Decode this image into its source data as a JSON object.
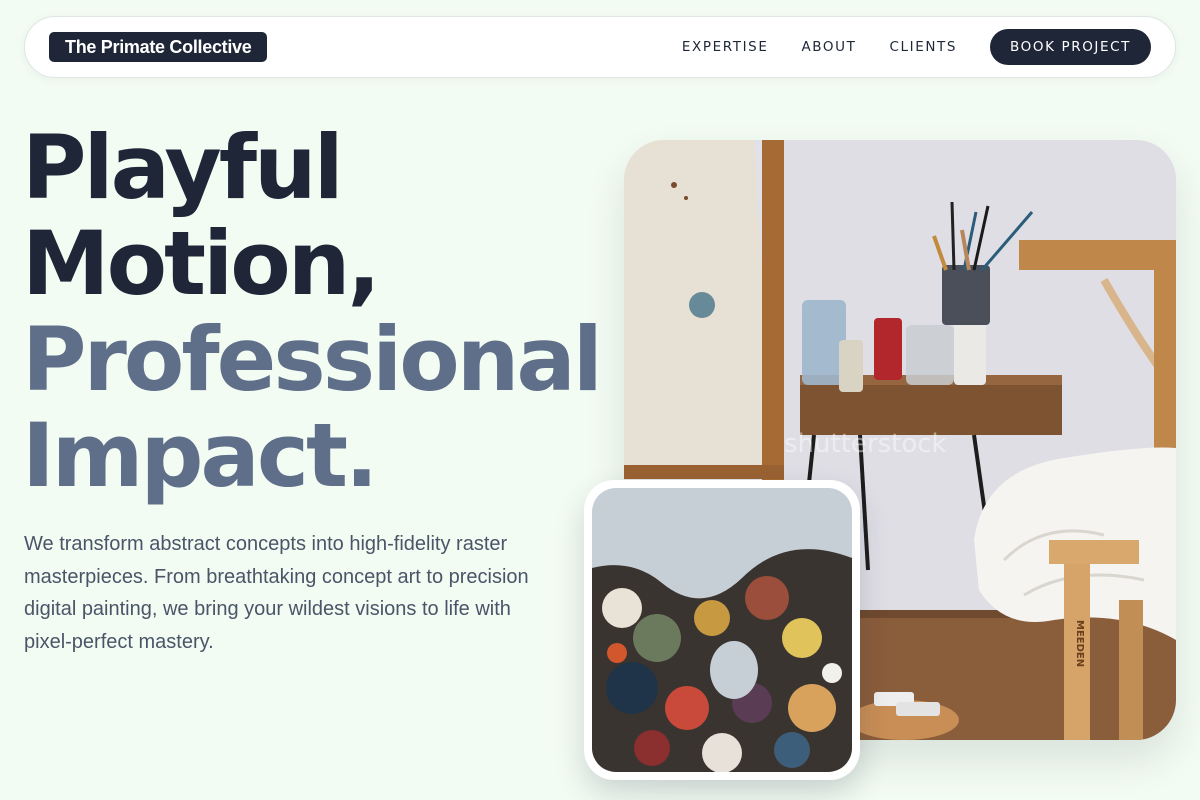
{
  "brand": {
    "name": "The Primate Collective"
  },
  "nav": {
    "links": [
      "EXPERTISE",
      "ABOUT",
      "CLIENTS"
    ],
    "cta": "BOOK PROJECT"
  },
  "hero": {
    "title_line1": "Playful",
    "title_line2": "Motion,",
    "title_line3": "Professional",
    "title_line4": "Impact.",
    "description": "We transform abstract concepts into high-fidelity raster masterpieces. From breathtaking concept art to precision digital painting, we bring your wildest visions to life with pixel-perfect mastery."
  },
  "images": {
    "studio_watermark": "shutterstock",
    "easel_brand": "MEEDEN"
  },
  "colors": {
    "background": "#f3fcf3",
    "primary": "#1e2638",
    "muted_heading": "#5f6f89",
    "body_text": "#4a5568"
  }
}
